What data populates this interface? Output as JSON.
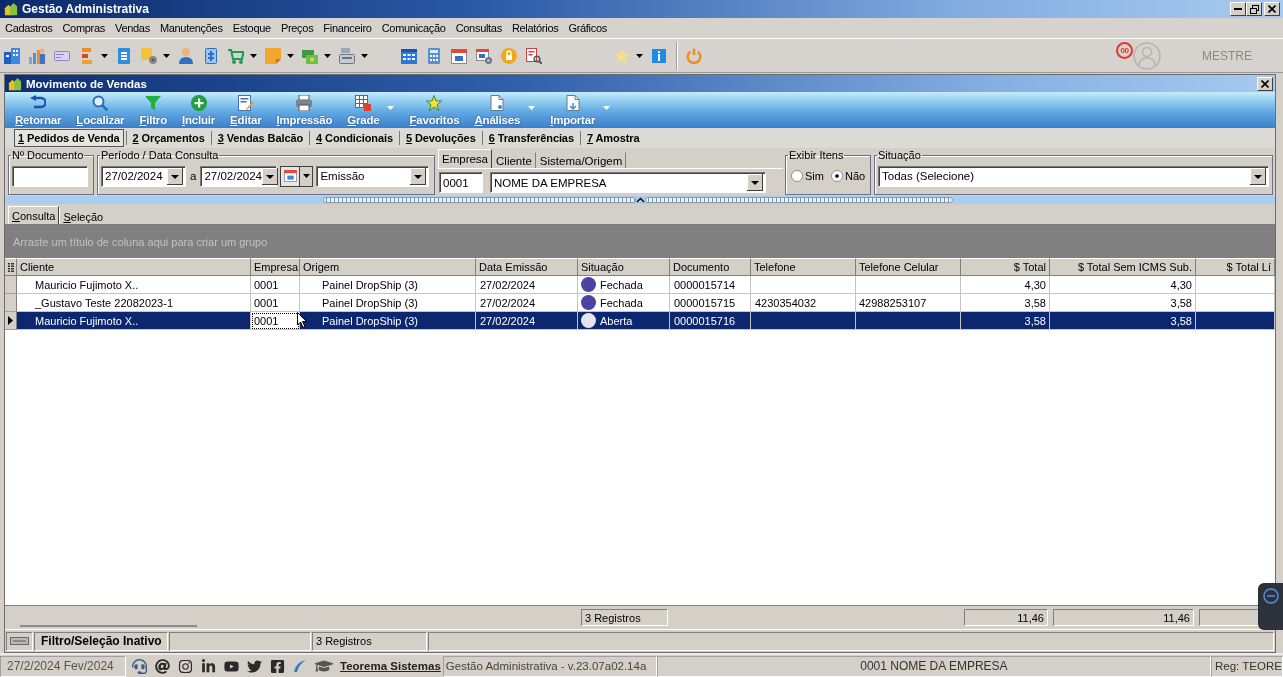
{
  "window": {
    "title": "Gestão Administrativa"
  },
  "menu": [
    "Cadastros",
    "Compras",
    "Vendas",
    "Manutenções",
    "Estoque",
    "Preços",
    "Financeiro",
    "Comunicação",
    "Consultas",
    "Relatórios",
    "Gráficos"
  ],
  "toolbar": {
    "groups": [
      [
        {
          "kind": "button",
          "dropdown": false
        },
        {
          "kind": "button",
          "dropdown": false
        },
        {
          "kind": "button",
          "dropdown": false
        },
        {
          "kind": "button",
          "dropdown": true
        },
        {
          "kind": "button",
          "dropdown": false
        },
        {
          "kind": "button",
          "dropdown": true
        },
        {
          "kind": "button",
          "dropdown": false
        },
        {
          "kind": "button",
          "dropdown": false
        },
        {
          "kind": "button",
          "dropdown": true
        },
        {
          "kind": "button",
          "dropdown": true
        },
        {
          "kind": "button",
          "dropdown": true
        },
        {
          "kind": "button",
          "dropdown": true
        }
      ],
      [
        {
          "kind": "button",
          "dropdown": false
        },
        {
          "kind": "button",
          "dropdown": false
        },
        {
          "kind": "button",
          "dropdown": false
        },
        {
          "kind": "button",
          "dropdown": false
        },
        {
          "kind": "button",
          "dropdown": false
        },
        {
          "kind": "button",
          "dropdown": false
        }
      ],
      [
        {
          "kind": "button",
          "dropdown": true
        },
        {
          "kind": "button",
          "dropdown": false
        },
        {
          "kind": "separator"
        },
        {
          "kind": "button",
          "dropdown": false
        }
      ]
    ],
    "badge": "00",
    "user": "MESTRE"
  },
  "child_window": {
    "title": "Movimento de Vendas",
    "actions": [
      {
        "label": "Retornar",
        "dropdown": false
      },
      {
        "label": "Localizar",
        "dropdown": false
      },
      {
        "label": "Filtro",
        "dropdown": false
      },
      {
        "label": "Incluir",
        "dropdown": false
      },
      {
        "label": "Editar",
        "dropdown": false
      },
      {
        "label": "Impressão",
        "dropdown": false
      },
      {
        "label": "Grade",
        "dropdown": true
      },
      {
        "label": "Favoritos",
        "dropdown": false
      },
      {
        "label": "Análises",
        "dropdown": true
      },
      {
        "label": "Importar",
        "dropdown": true
      }
    ]
  },
  "tabs": [
    {
      "label": "1 Pedidos de Venda",
      "selected": true
    },
    {
      "label": "2 Orçamentos",
      "selected": false
    },
    {
      "label": "3 Vendas Balcão",
      "selected": false
    },
    {
      "label": "4 Condicionais",
      "selected": false
    },
    {
      "label": "5 Devoluções",
      "selected": false
    },
    {
      "label": "6 Transferências",
      "selected": false
    },
    {
      "label": "7 Amostra",
      "selected": false
    }
  ],
  "filters": {
    "document": {
      "label": "Nº Documento"
    },
    "period": {
      "label": "Período / Data Consulta",
      "from": "27/02/2024",
      "separator": "a",
      "to": "27/02/2024",
      "date_type": "Emissão"
    },
    "entity": {
      "tabs": [
        {
          "label": "Empresa",
          "selected": true
        },
        {
          "label": "Cliente",
          "selected": false
        },
        {
          "label": "Sistema/Origem",
          "selected": false
        }
      ],
      "code": "0001",
      "name": "NOME DA EMPRESA"
    },
    "show_items": {
      "label": "Exibir Itens",
      "options": [
        {
          "label": "Sim",
          "selected": false
        },
        {
          "label": "Não",
          "selected": true
        }
      ]
    },
    "status": {
      "label": "Situação",
      "value": "Todas (Selecione)"
    }
  },
  "view_tabs": [
    {
      "label": "Consulta",
      "selected": true
    },
    {
      "label": "Seleção",
      "selected": false
    }
  ],
  "grid": {
    "group_hint": "Arraste um título de coluna aqui para criar um grupo",
    "columns": [
      "Cliente",
      "Empresa",
      "Origem",
      "Data Emissão",
      "Situação",
      "Documento",
      "Telefone",
      "Telefone Celular",
      "$ Total",
      "$ Total Sem ICMS Sub.",
      "$ Total Lí"
    ],
    "rows": [
      {
        "selected": false,
        "cells": [
          {
            "text": "Mauricio Fujimoto X..",
            "focused": false
          },
          {
            "text": "0001",
            "focused": false
          },
          {
            "text": "Painel DropShip (3)",
            "focused": false
          },
          {
            "text": "27/02/2024",
            "focused": false
          },
          {
            "text": "Fechada",
            "color": "#4a43a3",
            "focused": false
          },
          {
            "text": "0000015714",
            "focused": false
          },
          {
            "focused": false
          },
          {
            "focused": false
          },
          {
            "text": "4,30",
            "focused": false
          },
          {
            "text": "4,30",
            "focused": false
          },
          {
            "focused": false
          }
        ]
      },
      {
        "selected": false,
        "cells": [
          {
            "text": "_Gustavo Teste 22082023-1",
            "focused": false
          },
          {
            "text": "0001",
            "focused": false
          },
          {
            "text": "Painel DropShip (3)",
            "focused": false
          },
          {
            "text": "27/02/2024",
            "focused": false
          },
          {
            "text": "Fechada",
            "color": "#4a43a3",
            "focused": false
          },
          {
            "text": "0000015715",
            "focused": false
          },
          {
            "text": "4230354032",
            "focused": false
          },
          {
            "text": "42988253107",
            "focused": false
          },
          {
            "text": "3,58",
            "focused": false
          },
          {
            "text": "3,58",
            "focused": false
          },
          {
            "focused": false
          }
        ]
      },
      {
        "selected": true,
        "cells": [
          {
            "text": "Mauricio Fujimoto X..",
            "focused": false
          },
          {
            "text": "0001",
            "focused": true
          },
          {
            "text": "Painel DropShip (3)",
            "focused": false
          },
          {
            "text": "27/02/2024",
            "focused": false
          },
          {
            "text": "Aberta",
            "color": "#e4e4ea",
            "focused": false
          },
          {
            "text": "0000015716",
            "focused": false
          },
          {
            "focused": false
          },
          {
            "focused": false
          },
          {
            "text": "3,58",
            "focused": false
          },
          {
            "text": "3,58",
            "focused": false
          },
          {
            "focused": false
          }
        ]
      }
    ],
    "footer": {
      "count": "3 Registros",
      "totals": [
        "11,46",
        "11,46"
      ]
    }
  },
  "status_bar": {
    "filter": "Filtro/Seleção Inativo",
    "count": "3 Registros"
  },
  "app_status": {
    "date": "27/2/2024 Fev/2024",
    "link": "Teorema Sistemas",
    "version": "Gestão Administrativa - v.23.07a02.14a",
    "company": "0001 NOME DA EMPRESA",
    "registration": "Reg: TEORE"
  }
}
